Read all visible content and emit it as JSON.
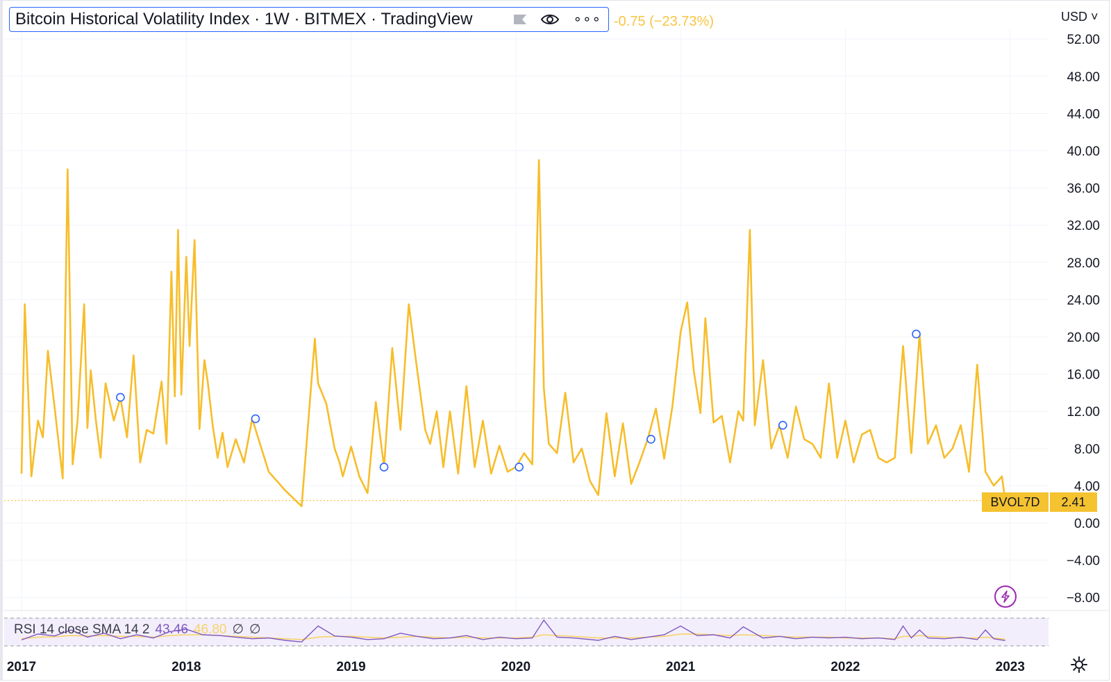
{
  "header": {
    "title": "Bitcoin Historical Volatility Index · 1W · BITMEX · TradingView",
    "change": "-0.75 (−23.73%)",
    "currency": "USD",
    "icons": [
      "flag-icon",
      "eye-icon",
      "more-icon"
    ]
  },
  "price_tag": {
    "name": "BVOL7D",
    "value": "2.41",
    "color": "#f5c230"
  },
  "rsi_legend": {
    "label": "RSI 14 close SMA 14 2",
    "value1": "43.46",
    "value2": "46.80",
    "na1": "∅",
    "na2": "∅"
  },
  "colors": {
    "line": "#f7bd2a",
    "rsi": "#7e57c2",
    "rsi_sma": "#f7d36b",
    "marker": "#2962ff",
    "grid": "#f0f3fa"
  },
  "chart_data": [
    {
      "type": "line",
      "name": "BVOL7D",
      "ylim": [
        -9.5,
        53
      ],
      "yticks": [
        "52.00",
        "48.00",
        "44.00",
        "40.00",
        "36.00",
        "32.00",
        "28.00",
        "24.00",
        "20.00",
        "16.00",
        "12.00",
        "8.00",
        "4.00",
        "0.00",
        "−4.00",
        "−8.00"
      ],
      "xticks": [
        "2017",
        "2018",
        "2019",
        "2020",
        "2021",
        "2022",
        "2023"
      ],
      "xlim": [
        2016.9,
        2023.2
      ],
      "last_value": 2.41,
      "x": [
        2017.0,
        2017.02,
        2017.06,
        2017.1,
        2017.13,
        2017.16,
        2017.2,
        2017.25,
        2017.28,
        2017.31,
        2017.34,
        2017.38,
        2017.4,
        2017.42,
        2017.45,
        2017.48,
        2017.51,
        2017.56,
        2017.6,
        2017.64,
        2017.68,
        2017.72,
        2017.76,
        2017.8,
        2017.85,
        2017.88,
        2017.91,
        2017.93,
        2017.95,
        2017.97,
        2018.0,
        2018.02,
        2018.05,
        2018.08,
        2018.11,
        2018.13,
        2018.16,
        2018.19,
        2018.22,
        2018.25,
        2018.3,
        2018.35,
        2018.4,
        2018.5,
        2018.6,
        2018.7,
        2018.78,
        2018.8,
        2018.85,
        2018.9,
        2018.93,
        2018.95,
        2019.0,
        2019.05,
        2019.1,
        2019.15,
        2019.2,
        2019.25,
        2019.3,
        2019.35,
        2019.4,
        2019.45,
        2019.48,
        2019.52,
        2019.56,
        2019.6,
        2019.65,
        2019.7,
        2019.75,
        2019.8,
        2019.85,
        2019.9,
        2019.95,
        2020.0,
        2020.05,
        2020.1,
        2020.14,
        2020.17,
        2020.2,
        2020.25,
        2020.3,
        2020.35,
        2020.4,
        2020.45,
        2020.5,
        2020.55,
        2020.6,
        2020.65,
        2020.7,
        2020.75,
        2020.8,
        2020.85,
        2020.9,
        2020.95,
        2021.0,
        2021.04,
        2021.08,
        2021.12,
        2021.15,
        2021.2,
        2021.25,
        2021.3,
        2021.35,
        2021.38,
        2021.42,
        2021.45,
        2021.5,
        2021.55,
        2021.6,
        2021.65,
        2021.7,
        2021.75,
        2021.8,
        2021.85,
        2021.9,
        2021.95,
        2022.0,
        2022.05,
        2022.1,
        2022.15,
        2022.2,
        2022.25,
        2022.3,
        2022.35,
        2022.4,
        2022.45,
        2022.5,
        2022.55,
        2022.6,
        2022.65,
        2022.7,
        2022.75,
        2022.8,
        2022.85,
        2022.9,
        2022.95,
        2022.97
      ],
      "y": [
        5.3,
        23.5,
        5.0,
        11.0,
        9.2,
        18.5,
        12.5,
        4.8,
        38.0,
        6.3,
        11.0,
        23.5,
        10.2,
        16.4,
        11.2,
        7.0,
        15.0,
        11.0,
        13.5,
        9.2,
        18.0,
        6.5,
        10.0,
        9.6,
        15.2,
        8.5,
        27.0,
        13.6,
        31.5,
        13.8,
        28.6,
        19.0,
        30.4,
        10.1,
        17.5,
        15.2,
        10.5,
        7.0,
        9.7,
        6.0,
        9.0,
        6.5,
        11.2,
        5.5,
        3.5,
        1.8,
        19.8,
        15.0,
        12.8,
        8.0,
        6.5,
        5.0,
        8.2,
        5.0,
        3.2,
        13.0,
        6.0,
        18.8,
        10.0,
        23.5,
        16.6,
        10.0,
        8.5,
        12.0,
        6.0,
        12.0,
        5.3,
        14.7,
        6.0,
        11.0,
        5.3,
        8.3,
        5.5,
        6.0,
        7.5,
        6.3,
        39.0,
        14.5,
        8.5,
        7.5,
        14.0,
        6.5,
        8.0,
        4.5,
        3.0,
        11.8,
        5.0,
        10.7,
        4.2,
        6.5,
        9.0,
        12.3,
        6.9,
        12.5,
        20.5,
        23.7,
        16.3,
        11.8,
        22.0,
        10.8,
        11.5,
        6.5,
        12.0,
        11.0,
        31.5,
        10.5,
        17.5,
        8.0,
        10.5,
        7.0,
        12.5,
        9.0,
        8.5,
        7.0,
        15.0,
        7.0,
        11.0,
        6.5,
        9.5,
        10.0,
        7.0,
        6.5,
        7.0,
        19.0,
        7.5,
        20.3,
        8.5,
        10.5,
        7.0,
        8.0,
        10.5,
        5.5,
        17.0,
        5.5,
        4.0,
        5.0,
        2.41
      ]
    },
    {
      "type": "line",
      "name": "RSI 14 close SMA 14 2",
      "ylim": [
        0,
        100
      ],
      "x": [
        2017.0,
        2017.1,
        2017.2,
        2017.3,
        2017.4,
        2017.5,
        2017.6,
        2017.7,
        2017.8,
        2017.9,
        2018.0,
        2018.1,
        2018.2,
        2018.3,
        2018.4,
        2018.5,
        2018.6,
        2018.7,
        2018.8,
        2018.9,
        2019.0,
        2019.1,
        2019.2,
        2019.3,
        2019.4,
        2019.5,
        2019.6,
        2019.7,
        2019.8,
        2019.9,
        2020.0,
        2020.1,
        2020.17,
        2020.25,
        2020.35,
        2020.5,
        2020.6,
        2020.7,
        2020.8,
        2020.9,
        2021.0,
        2021.1,
        2021.2,
        2021.3,
        2021.38,
        2021.5,
        2021.6,
        2021.7,
        2021.8,
        2021.9,
        2022.0,
        2022.1,
        2022.2,
        2022.3,
        2022.35,
        2022.4,
        2022.45,
        2022.5,
        2022.6,
        2022.7,
        2022.8,
        2022.85,
        2022.9,
        2022.97
      ],
      "y": [
        45,
        60,
        55,
        70,
        52,
        62,
        48,
        58,
        50,
        66,
        72,
        58,
        56,
        52,
        48,
        50,
        44,
        40,
        80,
        55,
        52,
        46,
        48,
        62,
        54,
        48,
        50,
        56,
        46,
        52,
        48,
        50,
        95,
        52,
        50,
        44,
        54,
        46,
        52,
        58,
        80,
        56,
        58,
        50,
        78,
        50,
        54,
        48,
        52,
        50,
        52,
        48,
        50,
        46,
        80,
        50,
        70,
        50,
        48,
        52,
        46,
        70,
        48,
        43.46
      ],
      "sma": [
        48,
        52,
        53,
        56,
        55,
        56,
        54,
        54,
        52,
        56,
        58,
        58,
        56,
        54,
        52,
        50,
        48,
        46,
        52,
        54,
        54,
        52,
        50,
        52,
        54,
        52,
        50,
        52,
        50,
        50,
        50,
        52,
        58,
        56,
        54,
        50,
        50,
        50,
        52,
        54,
        60,
        60,
        58,
        56,
        58,
        56,
        54,
        52,
        52,
        52,
        50,
        50,
        50,
        48,
        54,
        54,
        56,
        54,
        52,
        50,
        50,
        52,
        50,
        46.8
      ]
    }
  ]
}
